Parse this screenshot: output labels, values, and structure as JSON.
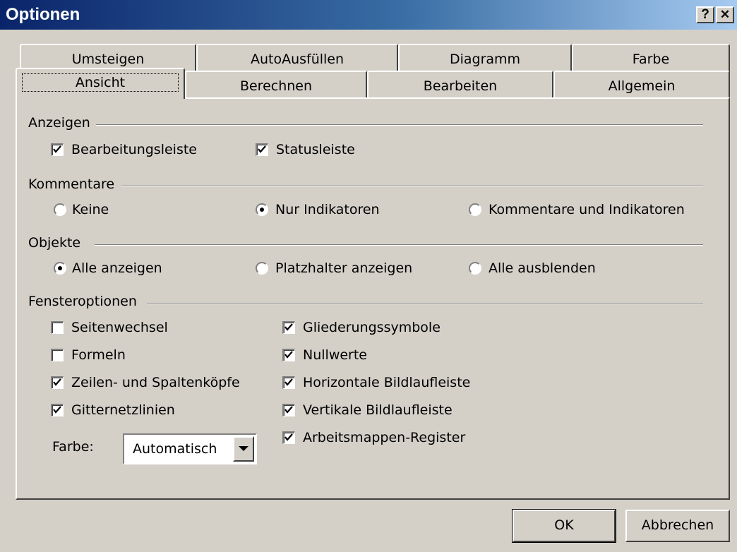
{
  "window": {
    "title": "Optionen",
    "help_btn": "?",
    "close_btn": "✕"
  },
  "tabs_row1": [
    "Umsteigen",
    "AutoAusfüllen",
    "Diagramm",
    "Farbe"
  ],
  "tabs_row2": [
    "Ansicht",
    "Berechnen",
    "Bearbeiten",
    "Allgemein"
  ],
  "groups": {
    "anzeigen": "Anzeigen",
    "kommentare": "Kommentare",
    "objekte": "Objekte",
    "fensteroptionen": "Fensteroptionen"
  },
  "anzeigen": {
    "bearbeitungsleiste": "Bearbeitungsleiste",
    "statusleiste": "Statusleiste"
  },
  "kommentare": {
    "keine": "Keine",
    "nur_indikatoren": "Nur Indikatoren",
    "kommentare_und_indikatoren": "Kommentare und Indikatoren"
  },
  "objekte": {
    "alle_anzeigen": "Alle anzeigen",
    "platzhalter": "Platzhalter anzeigen",
    "alle_ausblenden": "Alle ausblenden"
  },
  "fenster": {
    "seitenwechsel": "Seitenwechsel",
    "formeln": "Formeln",
    "zeilen_spalten": "Zeilen- und Spaltenköpfe",
    "gitternetz": "Gitternetzlinien",
    "farbe_label": "Farbe:",
    "farbe_value": "Automatisch",
    "gliederung": "Gliederungssymbole",
    "nullwerte": "Nullwerte",
    "horizontal": "Horizontale Bildlaufleiste",
    "vertikal": "Vertikale Bildlaufleiste",
    "register": "Arbeitsmappen-Register"
  },
  "buttons": {
    "ok": "OK",
    "cancel": "Abbrechen"
  }
}
